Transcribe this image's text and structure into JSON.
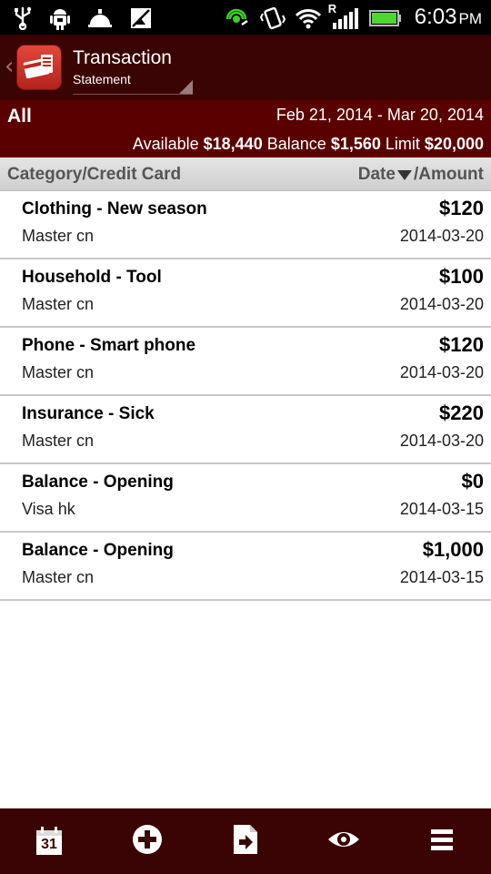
{
  "status_bar": {
    "time": "6:03",
    "ampm": "PM",
    "icons": [
      "usb-icon",
      "android-debug-icon",
      "bell-icon",
      "no-sd-icon",
      "sync-icon",
      "vibrate-icon",
      "wifi-icon",
      "signal-icon",
      "battery-icon"
    ],
    "roaming_label": "R"
  },
  "action_bar": {
    "title": "Transaction",
    "subtitle": "Statement"
  },
  "summary": {
    "filter": "All",
    "date_range": "Feb 21, 2014 - Mar 20, 2014",
    "available_label": "Available",
    "available_value": "$18,440",
    "balance_label": "Balance",
    "balance_value": "$1,560",
    "limit_label": "Limit",
    "limit_value": "$20,000"
  },
  "columns": {
    "left": "Category/Credit Card",
    "right_date": "Date",
    "right_amount": "/Amount"
  },
  "transactions": [
    {
      "category": "Clothing - New season",
      "amount": "$120",
      "card": "Master cn",
      "date": "2014-03-20"
    },
    {
      "category": "Household - Tool",
      "amount": "$100",
      "card": "Master cn",
      "date": "2014-03-20"
    },
    {
      "category": "Phone - Smart phone",
      "amount": "$120",
      "card": "Master cn",
      "date": "2014-03-20"
    },
    {
      "category": "Insurance - Sick",
      "amount": "$220",
      "card": "Master cn",
      "date": "2014-03-20"
    },
    {
      "category": "Balance - Opening",
      "amount": "$0",
      "card": "Visa hk",
      "date": "2014-03-15"
    },
    {
      "category": "Balance - Opening",
      "amount": "$1,000",
      "card": "Master cn",
      "date": "2014-03-15"
    }
  ],
  "bottom_bar": {
    "buttons": [
      "calendar-icon",
      "add-icon",
      "export-icon",
      "view-icon",
      "menu-icon"
    ],
    "calendar_day": "31"
  },
  "colors": {
    "action_bar": "#3a0404",
    "summary_bar": "#5a0000",
    "battery": "#4cd82c"
  }
}
